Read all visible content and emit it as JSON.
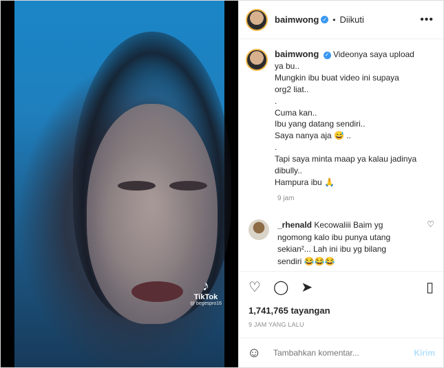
{
  "post": {
    "username": "baimwong",
    "follow_status": "Diikuti",
    "caption": {
      "username": "baimwong",
      "lines": [
        "Videonya saya upload",
        "ya bu..",
        "Mungkin ibu buat video ini supaya",
        "org2 liat..",
        ".",
        "Cuma kan..",
        "Ibu yang datang sendiri..",
        "Saya nanya aja 😅 ..",
        ".",
        "Tapi saya minta maap ya kalau jadinya",
        "dibully..",
        "Hampura ibu 🙏"
      ],
      "time": "9 jam"
    },
    "comment": {
      "username": "_rhenald",
      "text_lines": [
        "Kecowaliii Baim yg",
        "ngomong kalo ibu punya utang",
        "sekian²... Lah ini ibu yg bilang",
        "sendiri 😂😂😂"
      ]
    },
    "views": "1,741,765 tayangan",
    "posted_time": "9 JAM YANG LALU",
    "comment_box": {
      "placeholder": "Tambahkan komentar...",
      "send_label": "Kirim"
    },
    "watermark": {
      "logo": "♪",
      "brand": "TikTok",
      "handle": "@ begespro16"
    }
  }
}
